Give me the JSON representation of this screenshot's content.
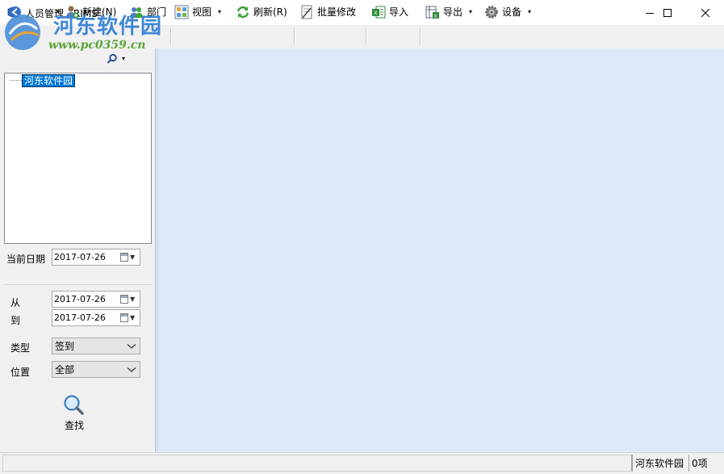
{
  "window": {
    "title": "人员管理 - RIMS"
  },
  "watermark": {
    "title": "河东软件园",
    "url": "www.pc0359.cn"
  },
  "toolbar": {
    "new_label": "新建(N)",
    "dept_label": "部门",
    "view_label": "视图",
    "refresh_label": "刷新(R)",
    "batch_label": "批量修改",
    "import_label": "导入",
    "export_label": "导出",
    "device_label": "设备"
  },
  "tree": {
    "root_label": "河东软件园"
  },
  "filters": {
    "current_date_label": "当前日期",
    "current_date_value": "2017-07-26",
    "from_label": "从",
    "from_value": "2017-07-26",
    "to_label": "到",
    "to_value": "2017-07-26",
    "type_label": "类型",
    "type_value": "签到",
    "location_label": "位置",
    "location_value": "全部",
    "find_label": "查找"
  },
  "statusbar": {
    "org": "河东软件园",
    "count": "0项"
  },
  "colors": {
    "main_bg": "#dce8f8",
    "selection": "#0078d7",
    "watermark_blue": "#3f87d6",
    "watermark_green": "#5aa33a"
  },
  "icons": [
    "app-icon",
    "new-person-icon",
    "department-icon",
    "view-icon",
    "refresh-icon",
    "batch-edit-icon",
    "import-icon",
    "export-icon",
    "device-gear-icon",
    "search-icon",
    "calendar-icon",
    "magnifier-icon"
  ]
}
